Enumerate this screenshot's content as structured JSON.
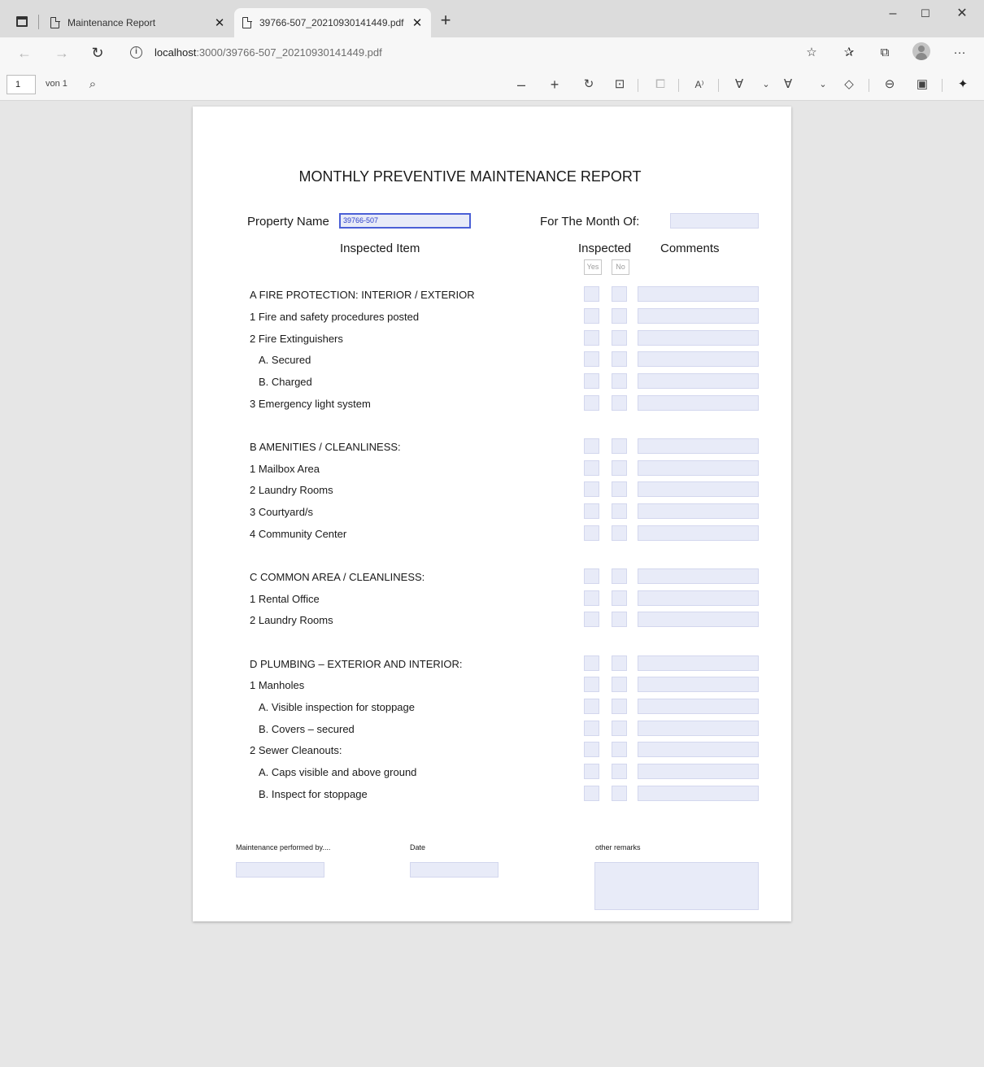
{
  "tabs": [
    {
      "title": "Maintenance Report",
      "active": false
    },
    {
      "title": "39766-507_20210930141449.pdf",
      "active": true
    }
  ],
  "window": {
    "minimize": "–",
    "maximize": "☐",
    "close": "✕"
  },
  "address": {
    "host": "localhost",
    "path": ":3000/39766-507_20210930141449.pdf"
  },
  "pdf_toolbar": {
    "page": "1",
    "page_of": "von 1"
  },
  "document": {
    "title": "MONTHLY PREVENTIVE MAINTENANCE REPORT",
    "property_label": "Property Name",
    "property_value": "39766-507",
    "month_label": "For The Month Of:",
    "month_value": "",
    "header_item": "Inspected Item",
    "header_inspected": "Inspected",
    "header_comments": "Comments",
    "yes": "Yes",
    "no": "No",
    "rows": [
      {
        "text": "A FIRE PROTECTION: INTERIOR / EXTERIOR",
        "indent": false
      },
      {
        "text": "1 Fire and safety procedures posted",
        "indent": false
      },
      {
        "text": "2 Fire Extinguishers",
        "indent": false
      },
      {
        "text": "A. Secured",
        "indent": true
      },
      {
        "text": "B. Charged",
        "indent": true
      },
      {
        "text": "3 Emergency light system",
        "indent": false
      },
      {
        "text": "B AMENITIES / CLEANLINESS:",
        "indent": false
      },
      {
        "text": "1 Mailbox Area",
        "indent": false
      },
      {
        "text": "2 Laundry Rooms",
        "indent": false
      },
      {
        "text": "3 Courtyard/s",
        "indent": false
      },
      {
        "text": "4 Community Center",
        "indent": false
      },
      {
        "text": "C COMMON AREA / CLEANLINESS:",
        "indent": false
      },
      {
        "text": "1 Rental Office",
        "indent": false
      },
      {
        "text": "2 Laundry Rooms",
        "indent": false
      },
      {
        "text": "D PLUMBING – EXTERIOR AND INTERIOR:",
        "indent": false
      },
      {
        "text": "1 Manholes",
        "indent": false
      },
      {
        "text": "A. Visible inspection for stoppage",
        "indent": true
      },
      {
        "text": "B. Covers – secured",
        "indent": true
      },
      {
        "text": "2 Sewer Cleanouts:",
        "indent": false
      },
      {
        "text": "A. Caps visible and above ground",
        "indent": true
      },
      {
        "text": "B. Inspect for stoppage",
        "indent": true
      }
    ],
    "footer": {
      "performed_by_label": "Maintenance performed by....",
      "date_label": "Date",
      "remarks_label": "other remarks"
    }
  },
  "colors": {
    "field_fill": "#e8ebf8",
    "focus_border": "#4a5fd6",
    "page_bg": "#e6e6e6"
  }
}
